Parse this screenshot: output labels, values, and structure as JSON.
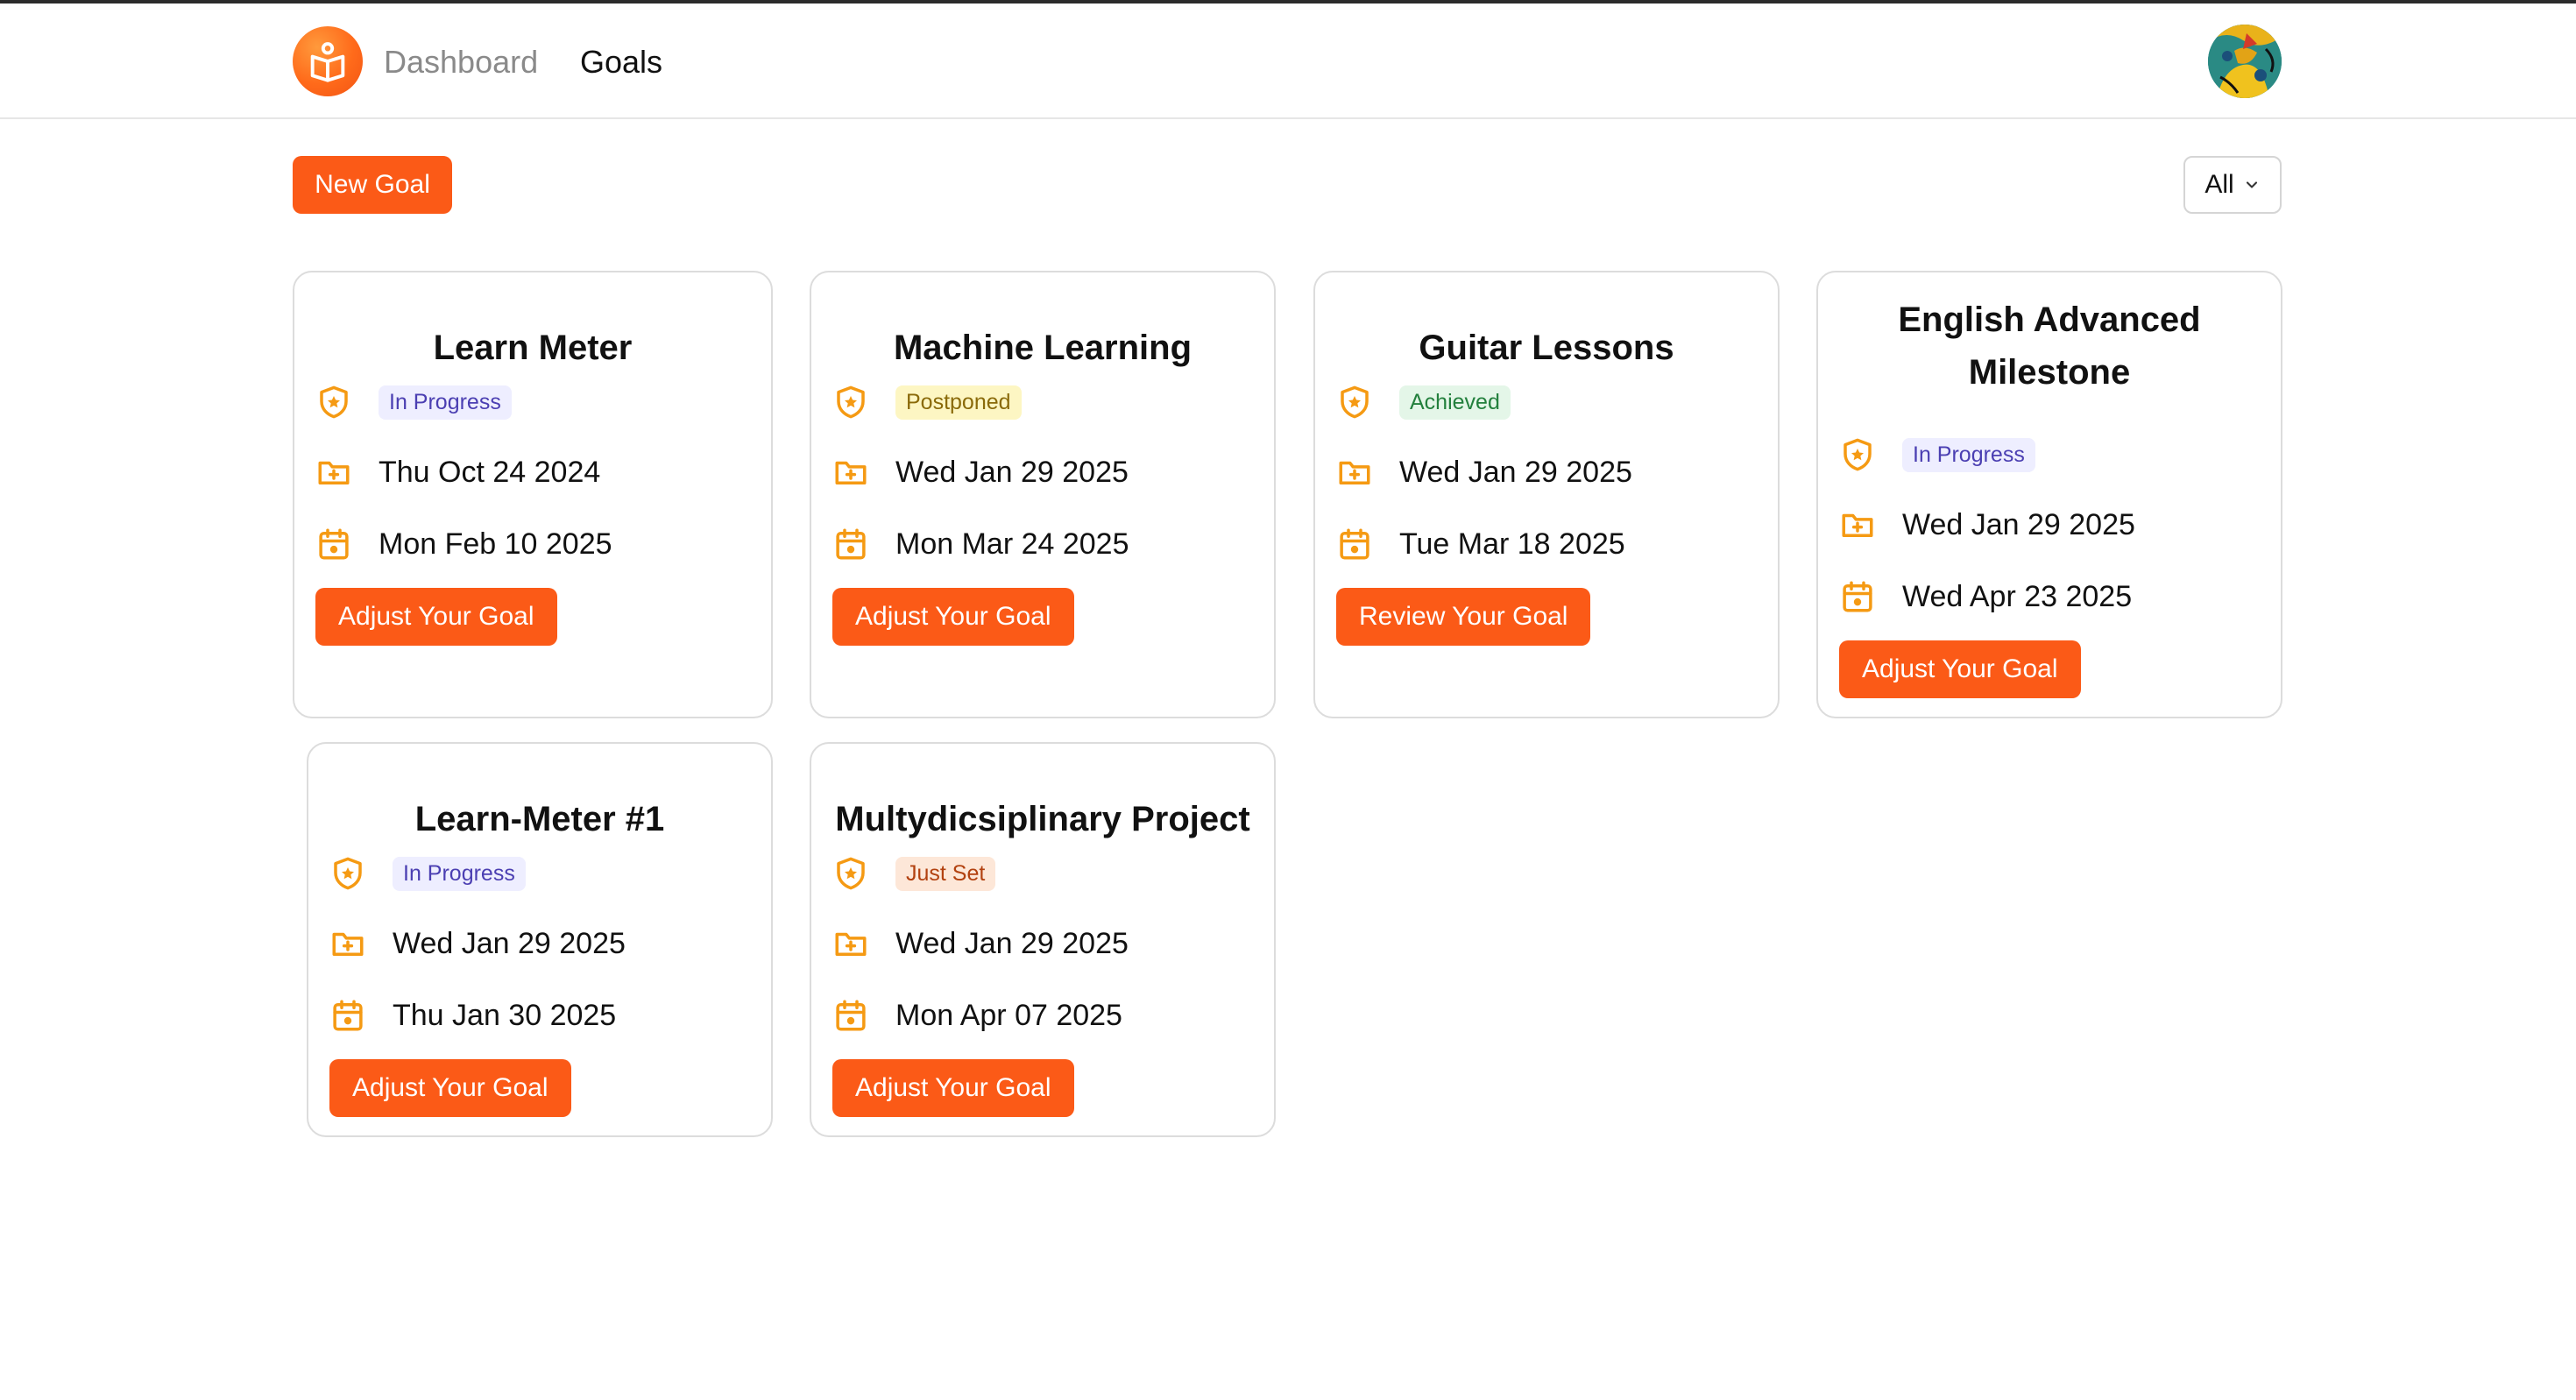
{
  "nav": {
    "dashboard": "Dashboard",
    "goals": "Goals"
  },
  "toolbar": {
    "new_goal": "New Goal",
    "filter_value": "All"
  },
  "colors": {
    "accent": "#fb5a17",
    "icon": "#f59a13"
  },
  "cards": [
    {
      "title": "Learn Meter",
      "status": "In Progress",
      "start": "Thu Oct 24 2024",
      "due": "Mon Feb 10 2025",
      "action": "Adjust Your Goal"
    },
    {
      "title": "Machine Learning",
      "status": "Postponed",
      "start": "Wed Jan 29 2025",
      "due": "Mon Mar 24 2025",
      "action": "Adjust Your Goal"
    },
    {
      "title": "Guitar Lessons",
      "status": "Achieved",
      "start": "Wed Jan 29 2025",
      "due": "Tue Mar 18 2025",
      "action": "Review Your Goal"
    },
    {
      "title_line1": "English Advanced",
      "title_line2": "Milestone",
      "status": "In Progress",
      "start": "Wed Jan 29 2025",
      "due": "Wed Apr 23 2025",
      "action": "Adjust Your Goal"
    },
    {
      "title": "Learn-Meter #1",
      "status": "In Progress",
      "start": "Wed Jan 29 2025",
      "due": "Thu Jan 30 2025",
      "action": "Adjust Your Goal"
    },
    {
      "title": "Multydicsiplinary Project",
      "status": "Just Set",
      "start": "Wed Jan 29 2025",
      "due": "Mon Apr 07 2025",
      "action": "Adjust Your Goal"
    }
  ]
}
